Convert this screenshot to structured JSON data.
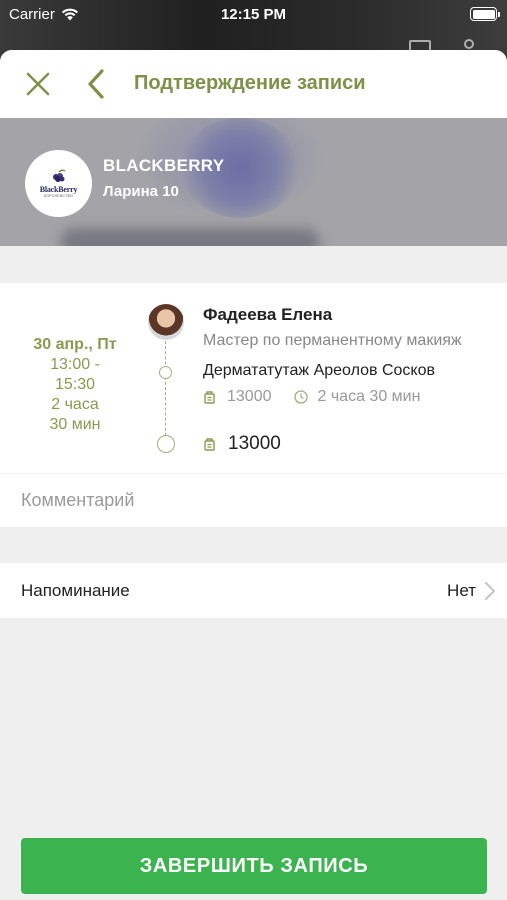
{
  "status_bar": {
    "carrier": "Carrier",
    "time": "12:15 PM"
  },
  "header": {
    "title": "Подтверждение записи"
  },
  "salon": {
    "name": "BLACKBERRY",
    "address": "Ларина 10",
    "logo_text": "BlackBerry",
    "logo_subtext": "КОРОЛЕВСТВО"
  },
  "appointment": {
    "date": "30 апр., Пт",
    "time_range": "13:00 -\n15:30",
    "duration": "2 часа\n30 мин",
    "master": {
      "name": "Фадеева Елена",
      "role": "Мастер по перманентному макияж"
    },
    "service": {
      "name": "Дермататутаж Ареолов Сосков",
      "price": "13000",
      "duration": "2 часа 30 мин"
    },
    "total": "13000"
  },
  "comment": {
    "placeholder": "Комментарий"
  },
  "reminder": {
    "label": "Напоминание",
    "value": "Нет"
  },
  "cta": {
    "label": "ЗАВЕРШИТЬ ЗАПИСЬ"
  },
  "colors": {
    "accent": "#7d9148",
    "date": "#8a9a50",
    "button": "#3bb34f"
  }
}
